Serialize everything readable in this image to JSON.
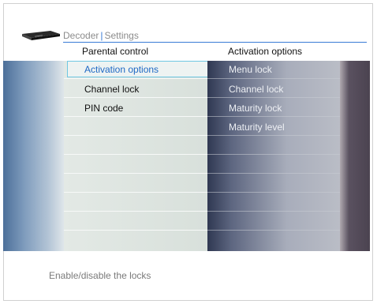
{
  "breadcrumb": {
    "part1": "Decoder",
    "separator": "|",
    "part2": "Settings"
  },
  "columns": {
    "left_header": "Parental control",
    "right_header": "Activation options"
  },
  "left_menu": {
    "selected_index": 0,
    "items": [
      "Activation options",
      "Channel lock",
      "PIN code"
    ]
  },
  "right_menu": {
    "items": [
      "Menu lock",
      "Channel lock",
      "Maturity lock",
      "Maturity level"
    ]
  },
  "footer": {
    "help_text": "Enable/disable the locks"
  },
  "colors": {
    "accent": "#3a7bd5",
    "selection_border": "#6fc7e3",
    "selected_text": "#1f69c4"
  },
  "icons": {
    "device": "decoder-device-icon"
  }
}
